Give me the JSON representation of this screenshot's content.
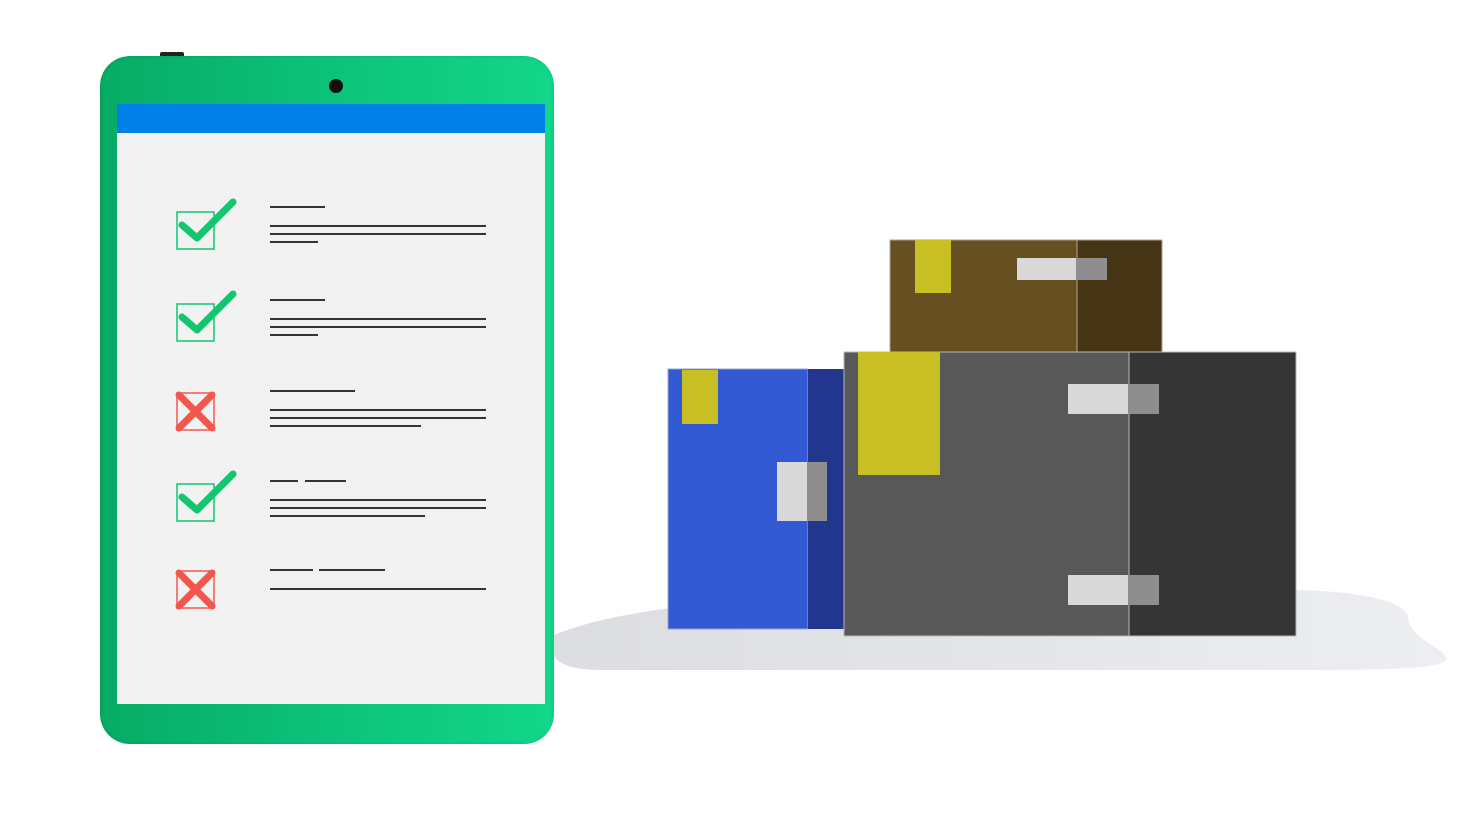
{
  "illustration": {
    "colors": {
      "tablet_green": "#0cc27a",
      "screen_header_blue": "#0080e6",
      "screen_bg": "#f2f2f2",
      "check_green": "#12c56e",
      "cross_red": "#f2574e",
      "box_blue": "#3259d4",
      "box_gray": "#585858",
      "box_brown": "#664f20",
      "label_yellow": "#c8bf24"
    },
    "checklist": [
      {
        "status": "check",
        "icon": "check-icon"
      },
      {
        "status": "check",
        "icon": "check-icon"
      },
      {
        "status": "cross",
        "icon": "cross-icon"
      },
      {
        "status": "check",
        "icon": "check-icon"
      },
      {
        "status": "cross",
        "icon": "cross-icon"
      }
    ],
    "boxes": [
      "blue-box",
      "gray-box",
      "brown-box"
    ]
  }
}
